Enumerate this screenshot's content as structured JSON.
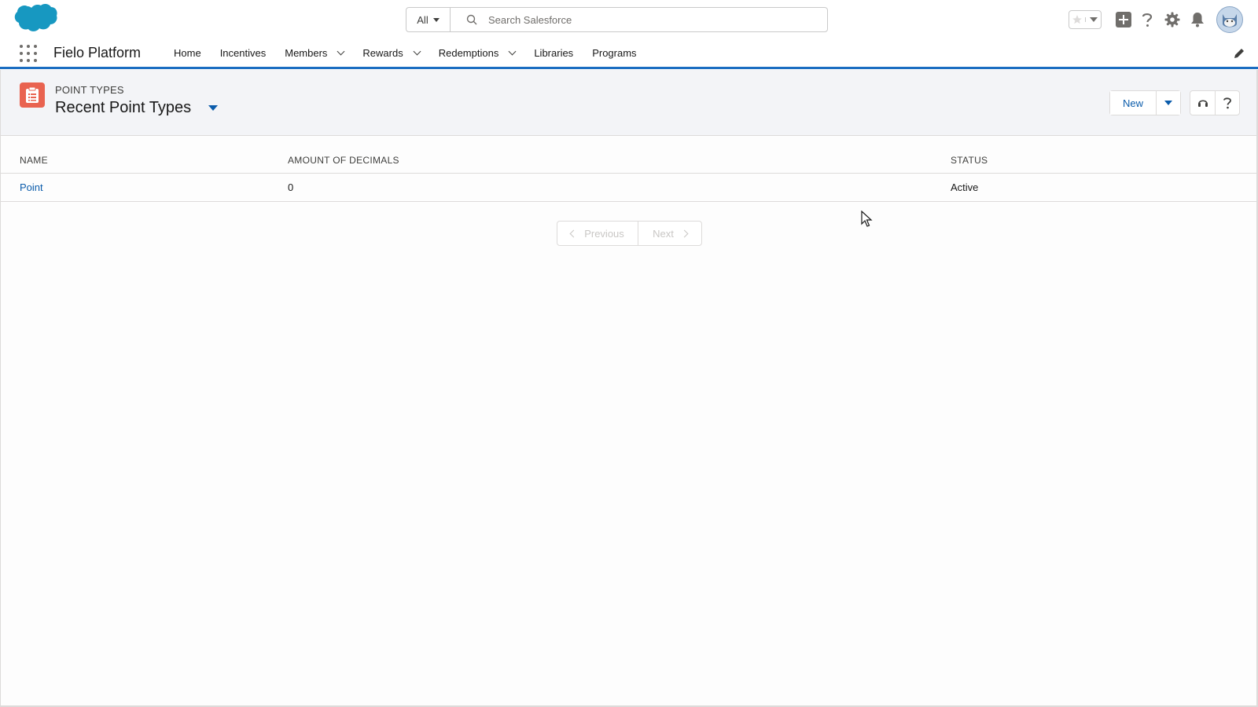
{
  "brand": {
    "logo_icon": "salesforce-cloud-logo",
    "color": "#1798c1"
  },
  "search": {
    "scope": "All",
    "placeholder": "Search Salesforce"
  },
  "utility_icons": [
    "favorite-star-icon",
    "add-icon",
    "help-icon",
    "setup-gear-icon",
    "notifications-bell-icon",
    "user-avatar"
  ],
  "app": {
    "name": "Fielo Platform"
  },
  "nav": {
    "items": [
      {
        "label": "Home",
        "has_menu": false
      },
      {
        "label": "Incentives",
        "has_menu": false
      },
      {
        "label": "Members",
        "has_menu": true
      },
      {
        "label": "Rewards",
        "has_menu": true
      },
      {
        "label": "Redemptions",
        "has_menu": true
      },
      {
        "label": "Libraries",
        "has_menu": false
      },
      {
        "label": "Programs",
        "has_menu": false
      }
    ]
  },
  "list_header": {
    "object_label": "POINT TYPES",
    "view_name": "Recent Point Types",
    "new_button": "New",
    "object_icon_color": "#e96350"
  },
  "table": {
    "columns": [
      "NAME",
      "AMOUNT OF DECIMALS",
      "STATUS"
    ],
    "rows": [
      {
        "name": "Point",
        "decimals": "0",
        "status": "Active"
      }
    ]
  },
  "pager": {
    "previous": "Previous",
    "next": "Next"
  },
  "colors": {
    "accent": "#1b6dc1",
    "link": "#0b5cab",
    "header_bg": "#f3f4f7"
  }
}
